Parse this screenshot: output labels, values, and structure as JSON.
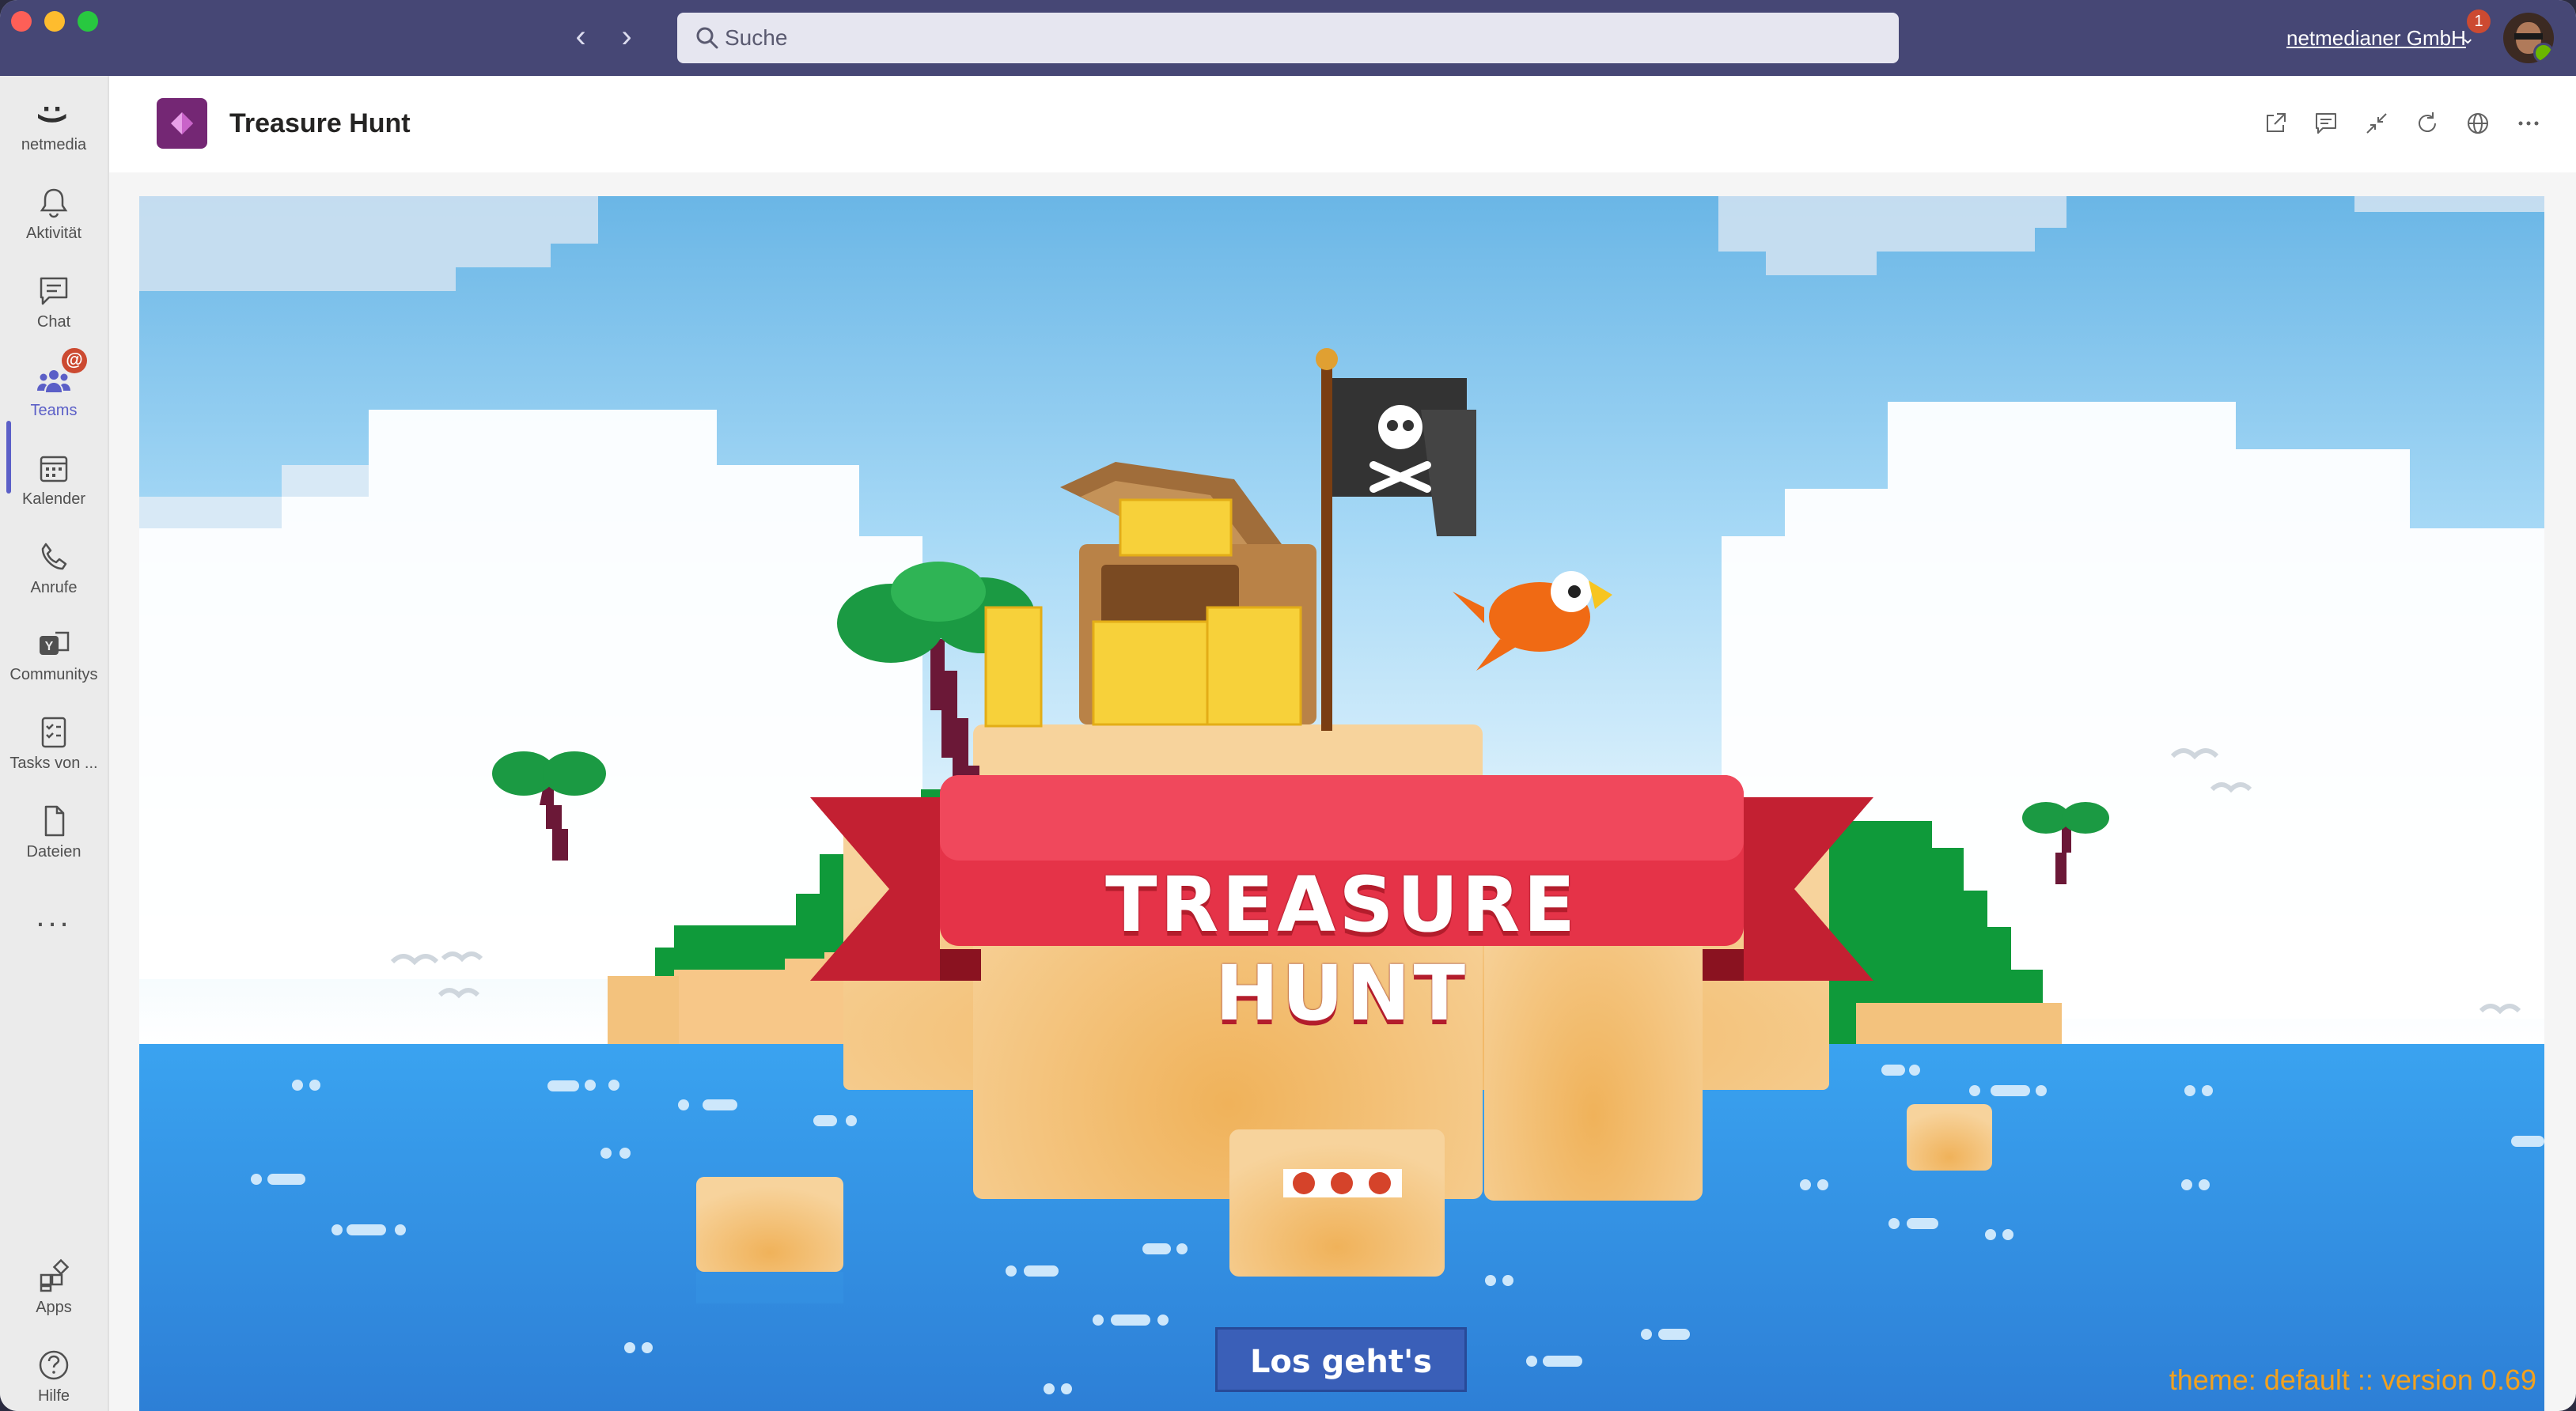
{
  "window": {
    "search_placeholder": "Suche",
    "organization": "netmedianer GmbH",
    "notification_count": "1"
  },
  "rail": {
    "items": [
      {
        "label": "netmedia",
        "icon": "smiley-icon"
      },
      {
        "label": "Aktivität",
        "icon": "bell-icon"
      },
      {
        "label": "Chat",
        "icon": "chat-icon"
      },
      {
        "label": "Teams",
        "icon": "teams-icon",
        "active": true,
        "badge": "@"
      },
      {
        "label": "Kalender",
        "icon": "calendar-icon"
      },
      {
        "label": "Anrufe",
        "icon": "phone-icon"
      },
      {
        "label": "Communitys",
        "icon": "communities-icon"
      },
      {
        "label": "Tasks von ...",
        "icon": "tasks-icon"
      },
      {
        "label": "Dateien",
        "icon": "files-icon"
      }
    ],
    "more": "...",
    "bottom": [
      {
        "label": "Apps",
        "icon": "apps-icon"
      },
      {
        "label": "Hilfe",
        "icon": "help-icon"
      }
    ],
    "netmedia_glyph": ":)"
  },
  "app": {
    "title": "Treasure Hunt"
  },
  "game": {
    "banner": "TREASURE HUNT",
    "start_button": "Los geht's",
    "version": "theme: default :: version 0.69"
  },
  "colors": {
    "titlebar": "#464775",
    "accent": "#5b5fc7",
    "brand": "#742774",
    "button": "#3a5fb8",
    "version_text": "#f1a11f"
  }
}
